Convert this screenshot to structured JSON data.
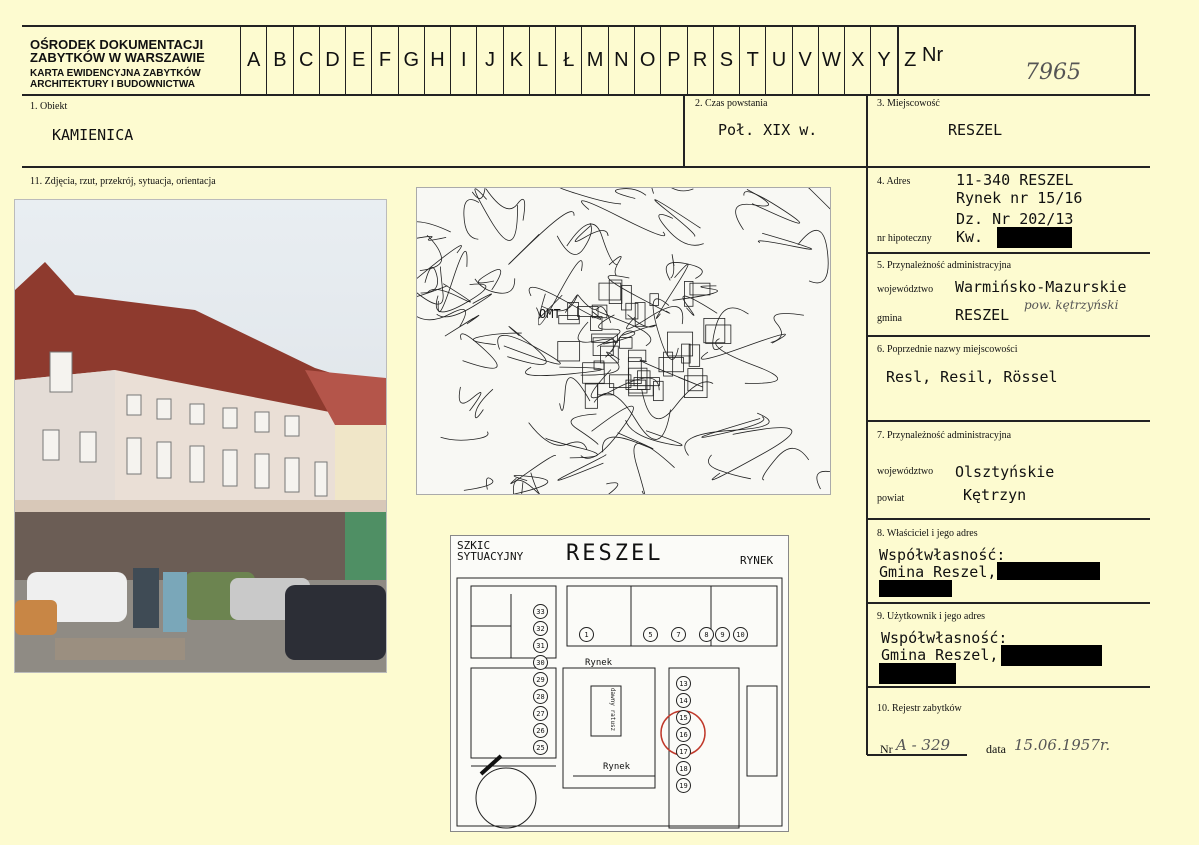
{
  "header": {
    "institution_line1": "OŚRODEK DOKUMENTACJI",
    "institution_line2": "ZABYTKÓW W WARSZAWIE",
    "card_type_line1": "KARTA EWIDENCYJNA ZABYTKÓW",
    "card_type_line2": "ARCHITEKTURY I BUDOWNICTWA",
    "letters": [
      "A",
      "B",
      "C",
      "D",
      "E",
      "F",
      "G",
      "H",
      "I",
      "J",
      "K",
      "L",
      "Ł",
      "M",
      "N",
      "O",
      "P",
      "R",
      "S",
      "T",
      "U",
      "V",
      "W",
      "X",
      "Y",
      "Z"
    ],
    "nr_label": "Nr",
    "nr_value": "7965"
  },
  "obiekt": {
    "label": "1. Obiekt",
    "value": "KAMIENICA"
  },
  "czas": {
    "label": "2. Czas powstania",
    "value": "Poł. XIX w."
  },
  "miejscowosc": {
    "label": "3. Miejscowość",
    "value": "RESZEL"
  },
  "zdjecia": {
    "label": "11. Zdjęcia, rzut, przekrój, sytuacja, orientacja"
  },
  "adres": {
    "label": "4. Adres",
    "line1": "11-340 RESZEL",
    "line2": "Rynek nr 15/16",
    "line3": "Dz.  Nr  202/13",
    "hipoteczny_label": "nr hipoteczny",
    "kw_label": "Kw."
  },
  "przynaleznosc": {
    "label": "5. Przynależność administracyjna",
    "woj_label": "województwo",
    "woj_value": "Warmińsko-Mazurskie",
    "gmina_label": "gmina",
    "gmina_value": "RESZEL",
    "gmina_note": "pow. kętrzyński"
  },
  "poprzednie": {
    "label": "6. Poprzednie nazwy miejscowości",
    "value": "Resl, Resil, Rössel"
  },
  "przynaleznosc_old": {
    "label": "7. Przynależność administracyjna",
    "woj_label": "województwo",
    "woj_value": "Olsztyńskie",
    "powiat_label": "powiat",
    "powiat_value": "Kętrzyn"
  },
  "wlasciciel": {
    "label": "8. Właściciel i jego adres",
    "line1": "Współwłasność:",
    "line2": "Gmina Reszel,"
  },
  "uzytkownik": {
    "label": "9. Użytkownik i jego adres",
    "line1": "Współwłasność:",
    "line2": "Gmina Reszel,"
  },
  "rejestr": {
    "label": "10.  Rejestr zabytków",
    "nr_label": "Nr",
    "nr_value": "A - 329",
    "data_label": "data",
    "data_value": "15.06.1957r."
  },
  "map": {
    "label": "OMT"
  },
  "sketch": {
    "title_line1": "SZKIC",
    "title_line2": "SYTUACYJNY",
    "town": "RESZEL",
    "area": "RYNEK",
    "street": "Rynek",
    "lot_numbers_top": [
      "1",
      "5",
      "7",
      "8",
      "9",
      "10"
    ],
    "lot_numbers_left": [
      "33",
      "32",
      "31",
      "30",
      "29",
      "28",
      "27",
      "26",
      "25"
    ],
    "lot_numbers_right": [
      "13",
      "14",
      "15",
      "16",
      "17",
      "18",
      "19"
    ],
    "hall_label": "dawny ratusz"
  }
}
